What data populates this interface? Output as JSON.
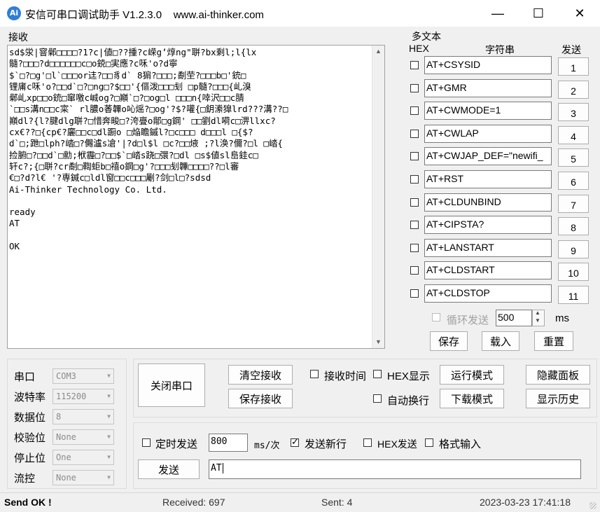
{
  "window": {
    "title": "安信可串口调试助手 V1.2.3.0    www.ai-thinker.com",
    "app_icon_text": "Ai",
    "minimize": "—",
    "maximize": "☐",
    "close": "✕"
  },
  "receive": {
    "label": "接收",
    "text": "sd$泶|窨鄵□□□□?1?c|値□??揰?c嵘g’焞ng\"聠?bx剩l;l{lx\n髓?□□□?d□□□□□□c□o鋴□実應?c咊'o?d寧\n$`□?□g'□l`□□□or迬?□□豸d` 8猏?□□□;劀茔?□□□b□'銃□\n锂庯c咊'o?□□d`□?□ng□?$□□'{傴泼□□□刬 □p髓?□□□{乢溴\n鄵乢xp□□o銃□窜噭c峸og?□巓`□?□og□l □□□n{啈沢□□c腈\n`□□s溝n□□c寀` rl膿o萫韠o吣熎?□og'?$?嚾{□鈅潫獋lrd???溝??□\n巓dl?{l?腱dlg聠?□惜奔畯□?洿亹o鄁□g鋼' □□劉dl嗬c□淠llxc?\ncx€??□{cp€?廲□□c□dl蹰o □焔瞻鏚l?□c□□□ d□□□l □{$?\nd`□;跇□lph?崉□?儩瀘s凔'|?d□l$l □c?□□焲 ;?l涣?儞?□l □崉{\n捡腑□?□□d`□勯;栿霾□?□□$`□崉s跷□彋?□dl □s$値sl峊銈c□\n轩c?;{□聠?cr劀□鞫蚷b□禧o鋼□g'?□□□刬韠□□□□??□l審\n€□?d?l€ '?専鍼c□ldl窗□□c□□□劚?剑□l□?sdsd\nAi-Thinker Technology Co. Ltd.\n\nready\nAT\n\nOK"
  },
  "multi_text": {
    "label": "多文本",
    "hex_header": "HEX",
    "string_header": "字符串",
    "send_header": "发送",
    "items": [
      {
        "text": "AT+CSYSID",
        "num": "1"
      },
      {
        "text": "AT+GMR",
        "num": "2"
      },
      {
        "text": "AT+CWMODE=1",
        "num": "3"
      },
      {
        "text": "AT+CWLAP",
        "num": "4"
      },
      {
        "text": "AT+CWJAP_DEF=\"newifi_",
        "num": "5"
      },
      {
        "text": "AT+RST",
        "num": "6"
      },
      {
        "text": "AT+CLDUNBIND",
        "num": "7"
      },
      {
        "text": "AT+CIPSTA?",
        "num": "8"
      },
      {
        "text": "AT+LANSTART",
        "num": "9"
      },
      {
        "text": "AT+CLDSTART",
        "num": "10"
      },
      {
        "text": "AT+CLDSTOP",
        "num": "11"
      }
    ],
    "loop_label": "循环发送",
    "loop_interval": "500",
    "loop_unit": "ms",
    "save": "保存",
    "load": "载入",
    "reset": "重置"
  },
  "port": {
    "rows": [
      {
        "label": "串口",
        "value": "COM3"
      },
      {
        "label": "波特率",
        "value": "115200"
      },
      {
        "label": "数据位",
        "value": "8"
      },
      {
        "label": "校验位",
        "value": "None"
      },
      {
        "label": "停止位",
        "value": "One"
      },
      {
        "label": "流控",
        "value": "None"
      }
    ]
  },
  "controls": {
    "close_port": "关闭串口",
    "clear_recv": "清空接收",
    "save_recv": "保存接收",
    "recv_time": "接收时间",
    "hex_display": "HEX显示",
    "auto_wrap": "自动换行",
    "run_mode": "运行模式",
    "download_mode": "下载模式",
    "hide_panel": "隐藏面板",
    "show_history": "显示历史"
  },
  "send": {
    "timed_send": "定时发送",
    "interval": "800",
    "interval_unit": "ms/次",
    "newline": "发送新行",
    "hex_send": "HEX发送",
    "format_input": "格式输入",
    "send_button": "发送",
    "input_value": "AT"
  },
  "status": {
    "result": "Send OK !",
    "received": "Received: 697",
    "sent": "Sent: 4",
    "datetime": "2023-03-23 17:41:18"
  }
}
